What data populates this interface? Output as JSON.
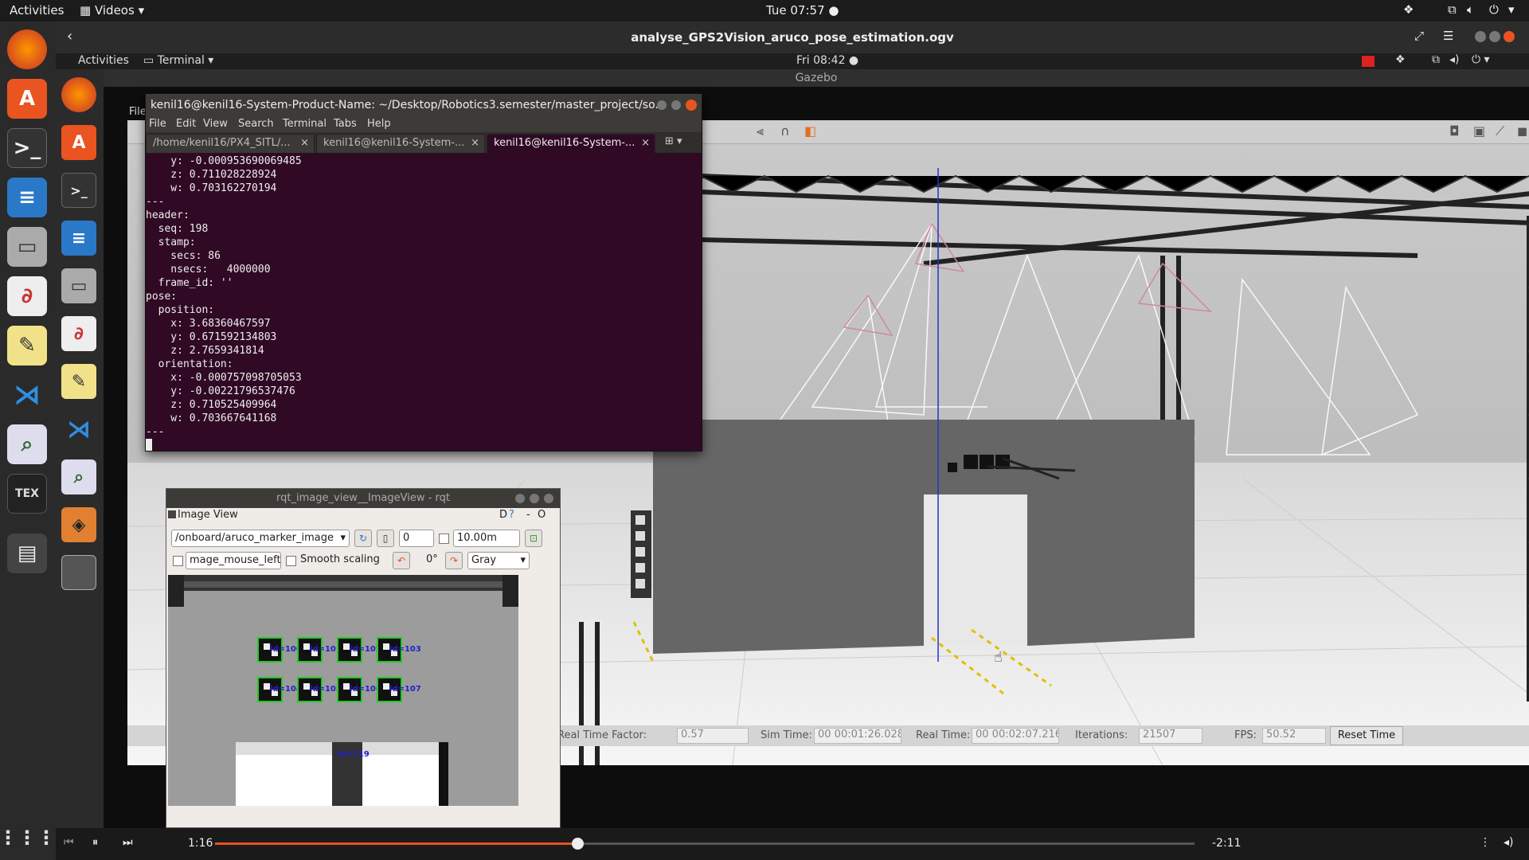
{
  "topbar": {
    "activities": "Activities",
    "app_menu": "Videos",
    "clock": "Tue 07:57"
  },
  "player": {
    "title": "analyse_GPS2Vision_aruco_pose_estimation.ogv",
    "elapsed": "1:16",
    "remaining": "-2:11",
    "progress": 0.37
  },
  "inner_desktop": {
    "activities": "Activities",
    "app_menu": "Terminal",
    "clock": "Fri 08:42"
  },
  "gazebo": {
    "window_title": "Gazebo",
    "left_clip_file": "File",
    "status": {
      "rtf_label": "Real Time Factor:",
      "rtf_value": "0.57",
      "sim_label": "Sim Time:",
      "sim_value": "00 00:01:26.028",
      "real_label": "Real Time:",
      "real_value": "00 00:02:07.216",
      "iter_label": "Iterations:",
      "iter_value": "21507",
      "fps_label": "FPS:",
      "fps_value": "50.52",
      "reset": "Reset Time"
    }
  },
  "terminal": {
    "title": "kenil16@kenil16-System-Product-Name: ~/Desktop/Robotics3.semester/master_project/so...",
    "menu": [
      "File",
      "Edit",
      "View",
      "Search",
      "Terminal",
      "Tabs",
      "Help"
    ],
    "tabs": [
      "/home/kenil16/PX4_SITL/...",
      "kenil16@kenil16-System-...",
      "kenil16@kenil16-System-..."
    ],
    "lines": [
      "    y: -0.000953690069485",
      "    z: 0.711028228924",
      "    w: 0.703162270194",
      "---",
      "header:",
      "  seq: 198",
      "  stamp:",
      "    secs: 86",
      "    nsecs:   4000000",
      "  frame_id: ''",
      "pose:",
      "  position:",
      "    x: 3.68360467597",
      "    y: 0.671592134803",
      "    z: 2.7659341814",
      "  orientation:",
      "    x: -0.000757098705053",
      "    y: -0.00221796537476",
      "    z: 0.710525409964",
      "    w: 0.703667641168",
      "---"
    ]
  },
  "rqt": {
    "title": "rqt_image_view__ImageView - rqt",
    "plugin": "Image View",
    "plugin_flags": "D",
    "topic": "/onboard/aruco_marker_image",
    "spin_value": "0",
    "max_value": "10.00m",
    "mouse_topic": "mage_mouse_left",
    "smooth": "Smooth scaling",
    "rotation": "0°",
    "colormap": "Gray",
    "markers_row1": [
      "id=100",
      "id=101",
      "id=102",
      "id=103"
    ],
    "markers_row2": [
      "id=104",
      "id=105",
      "id=106",
      "id=107"
    ],
    "marker_bottom": "id=119"
  }
}
